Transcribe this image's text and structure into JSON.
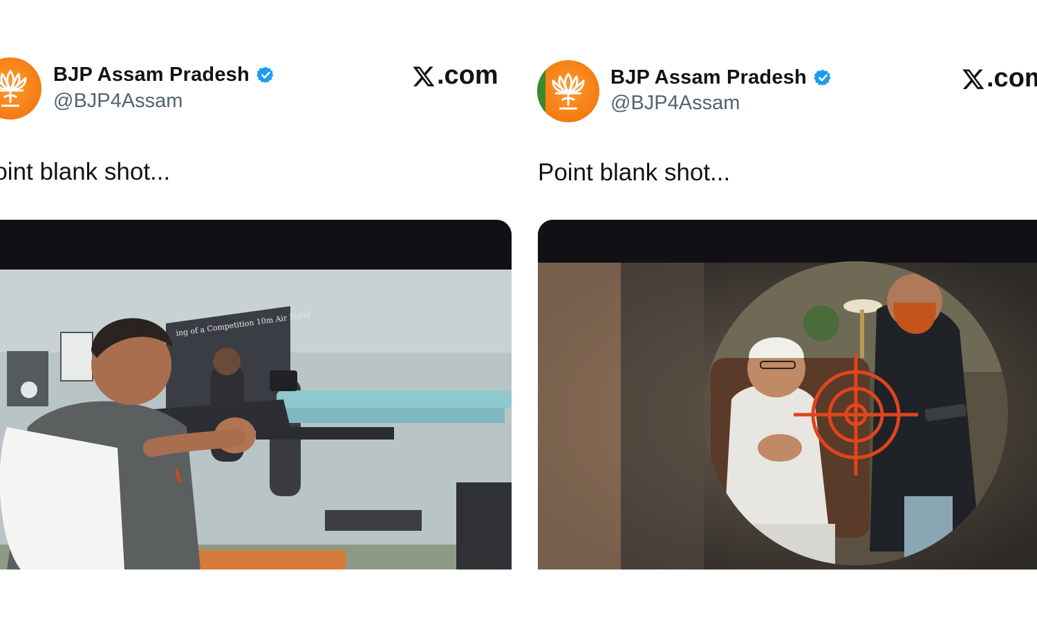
{
  "tweets": [
    {
      "account_name": "BJP Assam Pradesh",
      "handle": "@BJP4Assam",
      "site": ".com",
      "text": "Point blank shot...",
      "icons": {
        "avatar": "bjp-lotus-avatar",
        "verified": "verified-badge-icon",
        "site": "x-logo-icon"
      },
      "media": {
        "kind": "video-frame",
        "poster_text": "ing of a Competition 10m Air Pistol"
      }
    },
    {
      "account_name": "BJP Assam Pradesh",
      "handle": "@BJP4Assam",
      "site": ".com",
      "text": "Point blank shot...",
      "icons": {
        "avatar": "bjp-lotus-avatar",
        "verified": "verified-badge-icon",
        "site": "x-logo-icon"
      },
      "media": {
        "kind": "image",
        "overlay": "crosshair-target"
      }
    }
  ],
  "colors": {
    "verified": "#1d9bf0",
    "accent_orange": "#f47b13",
    "crosshair": "#e0451b",
    "handle_gray": "#536471"
  }
}
